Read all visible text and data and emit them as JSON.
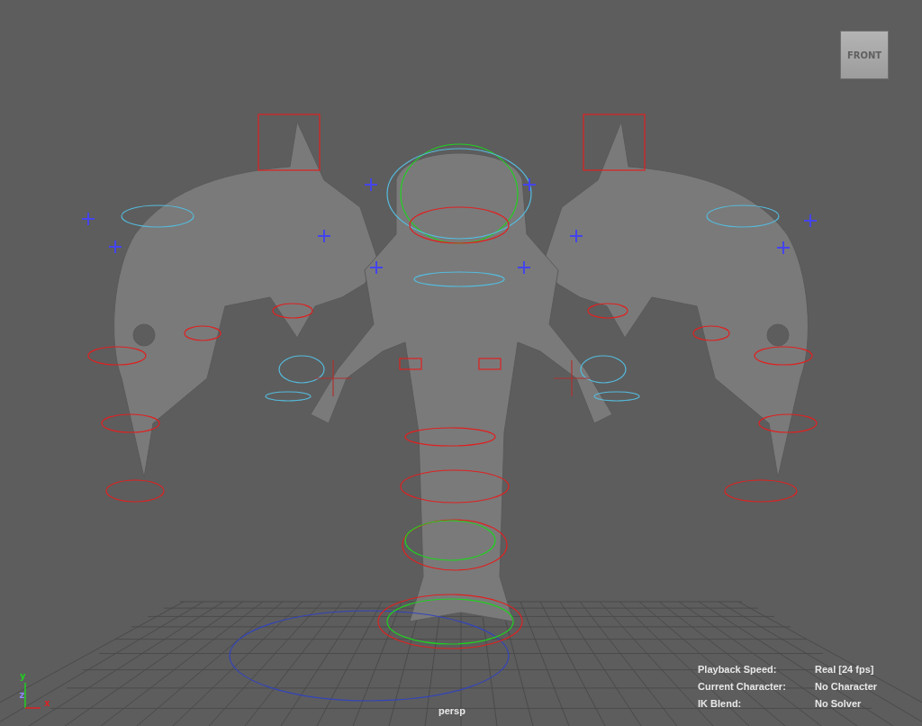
{
  "viewport": {
    "view_cube": {
      "label": "FRONT"
    },
    "axis": [
      {
        "kind": "y",
        "label": "y"
      },
      {
        "kind": "z",
        "label": "z"
      },
      {
        "kind": "x",
        "label": "x"
      }
    ],
    "hud": [
      {
        "label": "Playback Speed:",
        "value": "Real [24 fps]"
      },
      {
        "label": "Current Character:",
        "value": "No Character"
      },
      {
        "label": "IK Blend:",
        "value": "No Solver"
      }
    ],
    "camera": "persp"
  }
}
